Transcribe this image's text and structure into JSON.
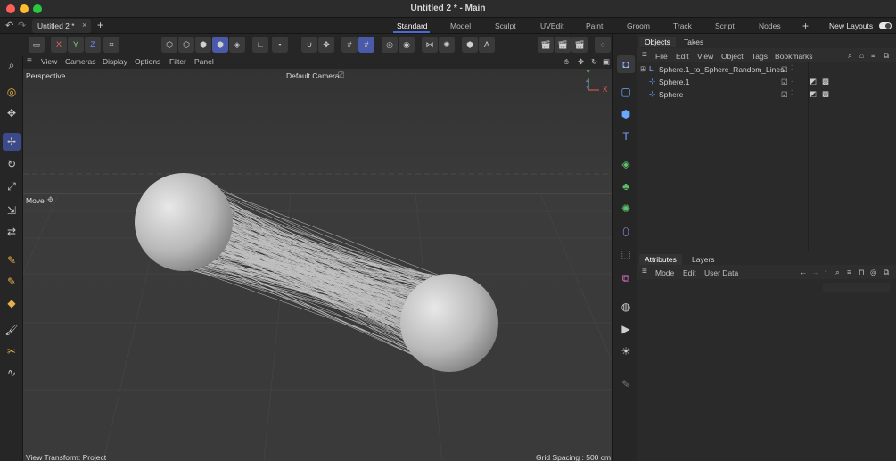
{
  "window": {
    "title": "Untitled 2 * - Main"
  },
  "doc_tab": {
    "label": "Untitled 2 *"
  },
  "workspaces": {
    "items": [
      "Standard",
      "Model",
      "Sculpt",
      "UVEdit",
      "Paint",
      "Groom",
      "Track",
      "Script",
      "Nodes"
    ],
    "active": "Standard",
    "new_layouts": "New Layouts"
  },
  "axis_toggles": {
    "x": "X",
    "y": "Y",
    "z": "Z"
  },
  "viewport_menu": {
    "items": [
      "View",
      "Cameras",
      "Display",
      "Options",
      "Filter",
      "Panel"
    ]
  },
  "viewport": {
    "projection": "Perspective",
    "camera": "Default Camera",
    "tool_label": "Move",
    "view_transform": "View Transform: Project",
    "grid_spacing": "Grid Spacing : 500 cm",
    "gizmo": {
      "y": "Y",
      "z": "Z",
      "x": "X"
    }
  },
  "objects_panel": {
    "tabs": [
      "Objects",
      "Takes"
    ],
    "active_tab": "Objects",
    "menu": [
      "File",
      "Edit",
      "View",
      "Object",
      "Tags",
      "Bookmarks"
    ],
    "rows": [
      {
        "name": "Sphere.1_to_Sphere_Random_Lines",
        "type": "null"
      },
      {
        "name": "Sphere.1",
        "type": "sphere"
      },
      {
        "name": "Sphere",
        "type": "sphere"
      }
    ]
  },
  "attributes_panel": {
    "tabs": [
      "Attributes",
      "Layers"
    ],
    "active_tab": "Attributes",
    "menu": [
      "Mode",
      "Edit",
      "User Data"
    ]
  },
  "colors": {
    "accent": "#4a6cd0",
    "viewport_bg": "#3a3a3a",
    "panel_bg": "#2a2a2a",
    "active_tool": "#4a5aa8"
  }
}
